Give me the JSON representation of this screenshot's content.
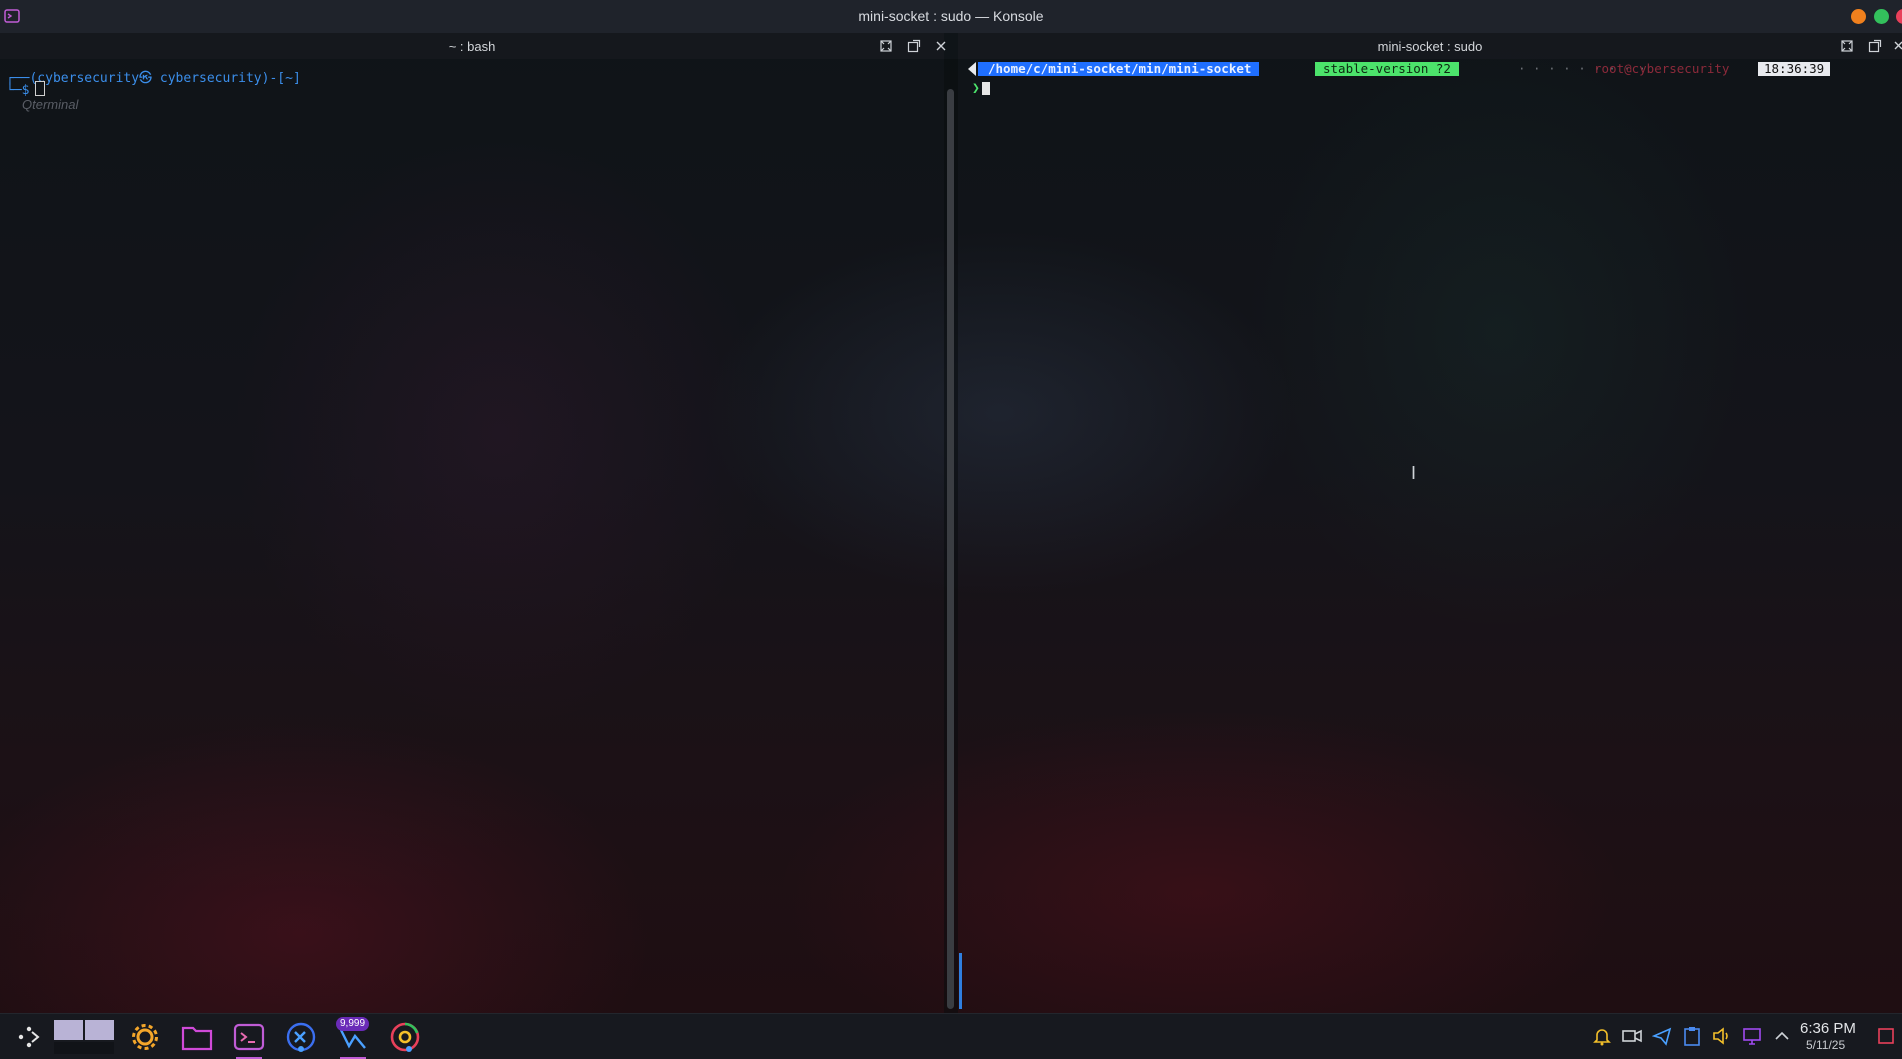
{
  "window": {
    "title": "mini-socket : sudo — Konsole",
    "colors": {
      "minimize": "#f0801d",
      "maximize": "#33c05c",
      "close": "#e8405a"
    }
  },
  "left_pane": {
    "tab_title": "~ : bash",
    "prompt_user": "(cybersecurity㉿ cybersecurity)-[~]",
    "prompt_symbol": "$",
    "ghost_hint": "Qterminal"
  },
  "right_pane": {
    "tab_title": "mini-socket : sudo",
    "path": "/home/c/mini-socket/min/mini-socket",
    "git_branch": "stable-version ?2",
    "dots": "· · · · · · · · ·",
    "user_host": "root@cybersecurity",
    "time": "18:36:39",
    "arrow": "❯"
  },
  "taskbar": {
    "badge_count": "9,999",
    "apps": [
      "launcher-icon",
      "settings-icon",
      "files-icon",
      "konsole-icon",
      "vscode-icon",
      "paint-icon",
      "chrome-icon"
    ],
    "tray": [
      "bell-icon",
      "camera-icon",
      "telegram-icon",
      "clipboard-icon",
      "volume-icon",
      "network-icon",
      "chevron-up-icon"
    ],
    "clock_time": "6:36 PM",
    "clock_date": "5/11/25"
  }
}
